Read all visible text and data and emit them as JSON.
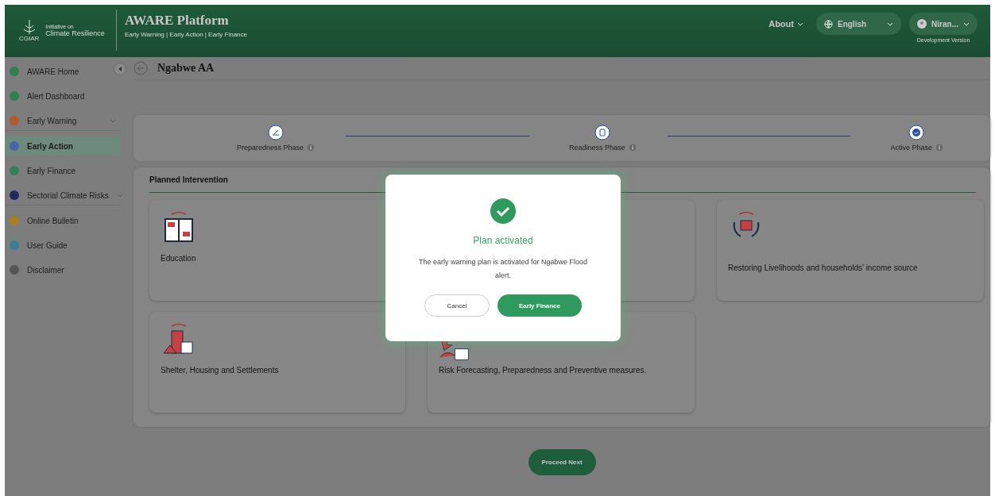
{
  "header": {
    "logo_text": "CGIAR",
    "initiative_label": "Initiative on",
    "initiative_name": "Climate Resilience",
    "title": "AWARE Platform",
    "subtitle": "Early Warning | Early Action | Early Finance",
    "about": "About",
    "language": "English",
    "user": "Niran...",
    "version": "Development Version"
  },
  "sidebar": {
    "items": [
      {
        "label": "AWARE Home",
        "color": "#2d7f55",
        "selected": false,
        "expandable": false
      },
      {
        "label": "Alert Dashboard",
        "color": "#2d7f55",
        "selected": false,
        "expandable": false
      },
      {
        "label": "Early Warning",
        "color": "#b25a2a",
        "selected": false,
        "expandable": true
      },
      {
        "label": "Early Action",
        "color": "#4863a8",
        "selected": true,
        "expandable": false
      },
      {
        "label": "Early Finance",
        "color": "#2f8258",
        "selected": false,
        "expandable": false
      },
      {
        "label": "Sectorial Climate Risks",
        "color": "#1f2a5e",
        "selected": false,
        "expandable": true
      },
      {
        "label": "Online Bulletin",
        "color": "#a8801c",
        "selected": false,
        "expandable": false
      },
      {
        "label": "User Guide",
        "color": "#3a7f9a",
        "selected": false,
        "expandable": false
      },
      {
        "label": "Disclaimer",
        "color": "#555555",
        "selected": false,
        "expandable": false
      }
    ]
  },
  "page_title": "Ngabwe AA",
  "phases": [
    {
      "label": "Preparedness Phase",
      "kind": "pen"
    },
    {
      "label": "Readiness Phase",
      "kind": "doc"
    },
    {
      "label": "Active Phase",
      "kind": "check"
    }
  ],
  "section_title": "Planned Intervention",
  "cards": [
    {
      "title": "Education",
      "kind": "book"
    },
    {
      "kind": "covered"
    },
    {
      "title": "Restoring Livelihoods and households’ income source",
      "kind": "hands"
    },
    {
      "title": "Shelter, Housing and Settlements",
      "kind": "houses"
    },
    {
      "title": "Risk Forecasting, Preparedness and Preventive measures.",
      "kind": "storm"
    }
  ],
  "proceed_button": "Proceed Next",
  "dialog": {
    "title": "Plan activated",
    "message": "The early warning plan is activated for Ngabwe Flood alert.",
    "cancel": "Cancel",
    "confirm": "Early Finance"
  }
}
